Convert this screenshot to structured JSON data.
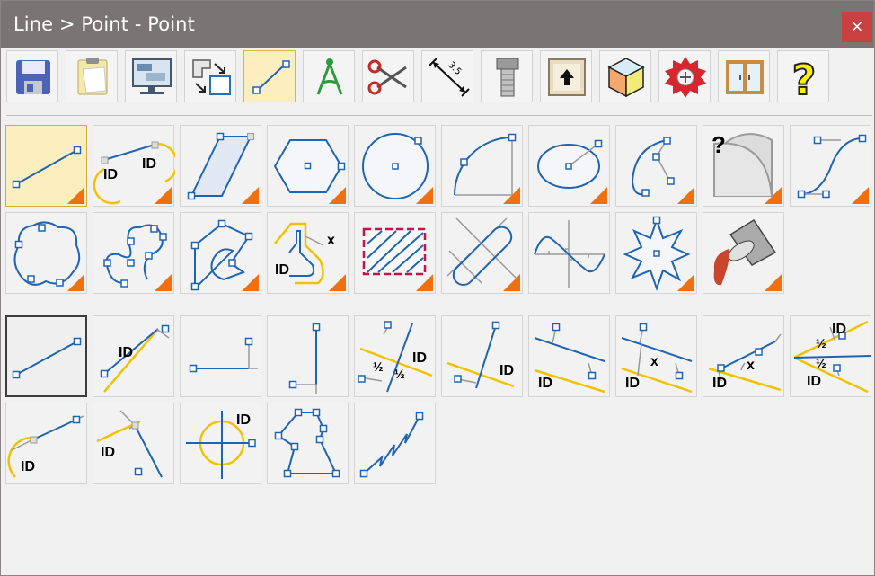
{
  "window": {
    "title": "Line > Point - Point",
    "close_glyph": "×"
  },
  "toolbar": {
    "items": [
      {
        "name": "save-icon",
        "active": false
      },
      {
        "name": "clipboard-icon",
        "active": false
      },
      {
        "name": "computer-screens-icon",
        "active": false
      },
      {
        "name": "transform-shapes-icon",
        "active": false
      },
      {
        "name": "line-icon",
        "active": true
      },
      {
        "name": "compass-icon",
        "active": false
      },
      {
        "name": "scissors-icon",
        "active": false
      },
      {
        "name": "dimension-icon",
        "active": false,
        "label": "3.5"
      },
      {
        "name": "bolt-icon",
        "active": false
      },
      {
        "name": "up-arrow-key-icon",
        "active": false
      },
      {
        "name": "cube-icon",
        "active": false
      },
      {
        "name": "saw-blade-icon",
        "active": false
      },
      {
        "name": "window-icon",
        "active": false
      },
      {
        "name": "help-question-icon",
        "active": false
      }
    ]
  },
  "shapes_grid": {
    "items": [
      {
        "name": "line-shape",
        "active": true
      },
      {
        "name": "tangent-arcs-shape",
        "labels": [
          "ID",
          "ID"
        ]
      },
      {
        "name": "parallelogram-shape"
      },
      {
        "name": "hexagon-shape"
      },
      {
        "name": "circle-shape"
      },
      {
        "name": "arc-shape"
      },
      {
        "name": "ellipse-shape"
      },
      {
        "name": "elliptical-arc-shape"
      },
      {
        "name": "unknown-sector-shape",
        "labels": [
          "?"
        ]
      },
      {
        "name": "s-curve-shape"
      },
      {
        "name": "closed-spline-shape"
      },
      {
        "name": "open-spline-shape"
      },
      {
        "name": "polyline-shape"
      },
      {
        "name": "offset-contour-shape",
        "labels": [
          "ID",
          "x"
        ]
      },
      {
        "name": "hatch-area-shape"
      },
      {
        "name": "slot-shape"
      },
      {
        "name": "sine-curve-shape"
      },
      {
        "name": "star-shape"
      },
      {
        "name": "paint-bucket-shape"
      }
    ]
  },
  "line_modes": {
    "items": [
      {
        "name": "point-point-line",
        "selected": true
      },
      {
        "name": "line-at-distance",
        "labels": [
          "ID"
        ]
      },
      {
        "name": "horizontal-line"
      },
      {
        "name": "vertical-line"
      },
      {
        "name": "bisector-line",
        "labels": [
          "ID",
          "½",
          "½"
        ]
      },
      {
        "name": "angle-line",
        "labels": [
          "ID"
        ]
      },
      {
        "name": "parallel-line",
        "labels": [
          "ID"
        ]
      },
      {
        "name": "parallel-distance-line",
        "labels": [
          "ID",
          "x"
        ]
      },
      {
        "name": "angle-distance-line",
        "labels": [
          "ID",
          "x"
        ]
      },
      {
        "name": "angle-bisector-line",
        "labels": [
          "ID",
          "½",
          "½",
          "ID"
        ]
      },
      {
        "name": "tangent-line",
        "labels": [
          "ID"
        ]
      },
      {
        "name": "perpendicular-line",
        "labels": [
          "ID"
        ]
      },
      {
        "name": "center-cross-line",
        "labels": [
          "ID"
        ]
      },
      {
        "name": "polyline-mode"
      },
      {
        "name": "zigzag-line"
      }
    ]
  }
}
